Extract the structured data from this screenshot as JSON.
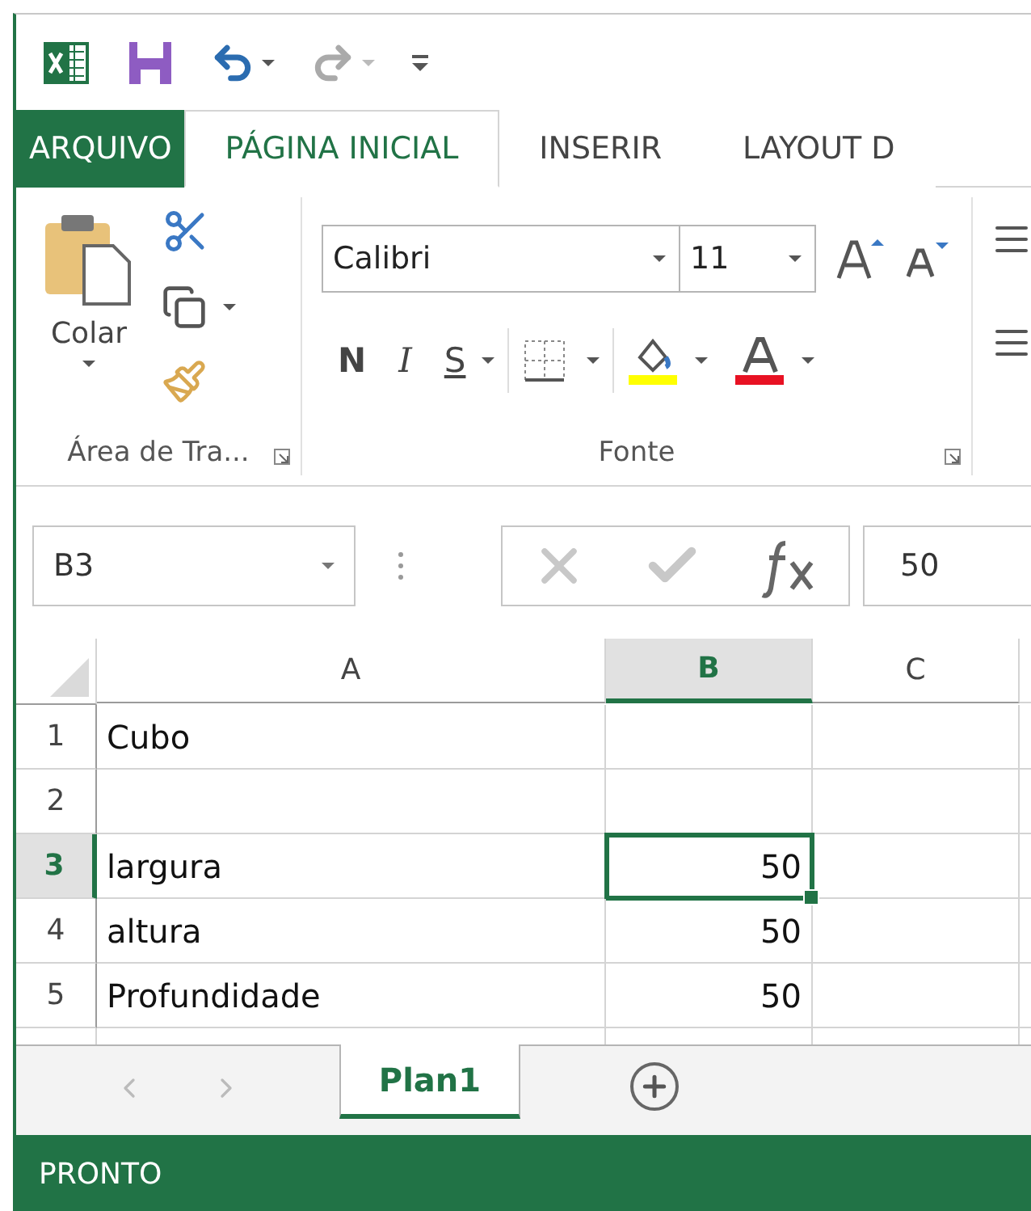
{
  "quick_access": {
    "undo_enabled": true,
    "redo_enabled": false
  },
  "tabs": [
    {
      "label": "ARQUIVO",
      "kind": "file",
      "selected": false
    },
    {
      "label": "PÁGINA INICIAL",
      "kind": "tab",
      "selected": true
    },
    {
      "label": "INSERIR",
      "kind": "tab",
      "selected": false
    },
    {
      "label": "LAYOUT D",
      "kind": "tab",
      "selected": false
    }
  ],
  "ribbon": {
    "clipboard": {
      "paste_label": "Colar",
      "group_label": "Área de Tra..."
    },
    "font": {
      "font_name": "Calibri",
      "font_size": "11",
      "bold": "N",
      "italic": "I",
      "underline": "S",
      "group_label": "Fonte"
    }
  },
  "formula_bar": {
    "name_box": "B3",
    "value": "50"
  },
  "columns": [
    {
      "label": "A",
      "selected": false
    },
    {
      "label": "B",
      "selected": true
    },
    {
      "label": "C",
      "selected": false
    }
  ],
  "rows": [
    {
      "number": "1",
      "selected": false,
      "cells": [
        {
          "kind": "text",
          "value": "Cubo",
          "selected": false
        },
        {
          "kind": "empty",
          "selected": false
        }
      ]
    },
    {
      "number": "2",
      "selected": false,
      "cells": [
        {
          "kind": "empty",
          "selected": false
        },
        {
          "kind": "empty",
          "selected": false
        }
      ]
    },
    {
      "number": "3",
      "selected": true,
      "cells": [
        {
          "kind": "text",
          "value": "largura",
          "selected": false
        },
        {
          "kind": "number",
          "value": "50",
          "selected": true
        }
      ]
    },
    {
      "number": "4",
      "selected": false,
      "cells": [
        {
          "kind": "text",
          "value": "altura",
          "selected": false
        },
        {
          "kind": "number",
          "value": "50",
          "selected": false
        }
      ]
    },
    {
      "number": "5",
      "selected": false,
      "cells": [
        {
          "kind": "text",
          "value": "Profundidade",
          "selected": false
        },
        {
          "kind": "number",
          "value": "50",
          "selected": false
        }
      ]
    }
  ],
  "sheets": [
    {
      "label": "Plan1",
      "selected": true
    }
  ],
  "status_bar": {
    "text": "PRONTO"
  }
}
